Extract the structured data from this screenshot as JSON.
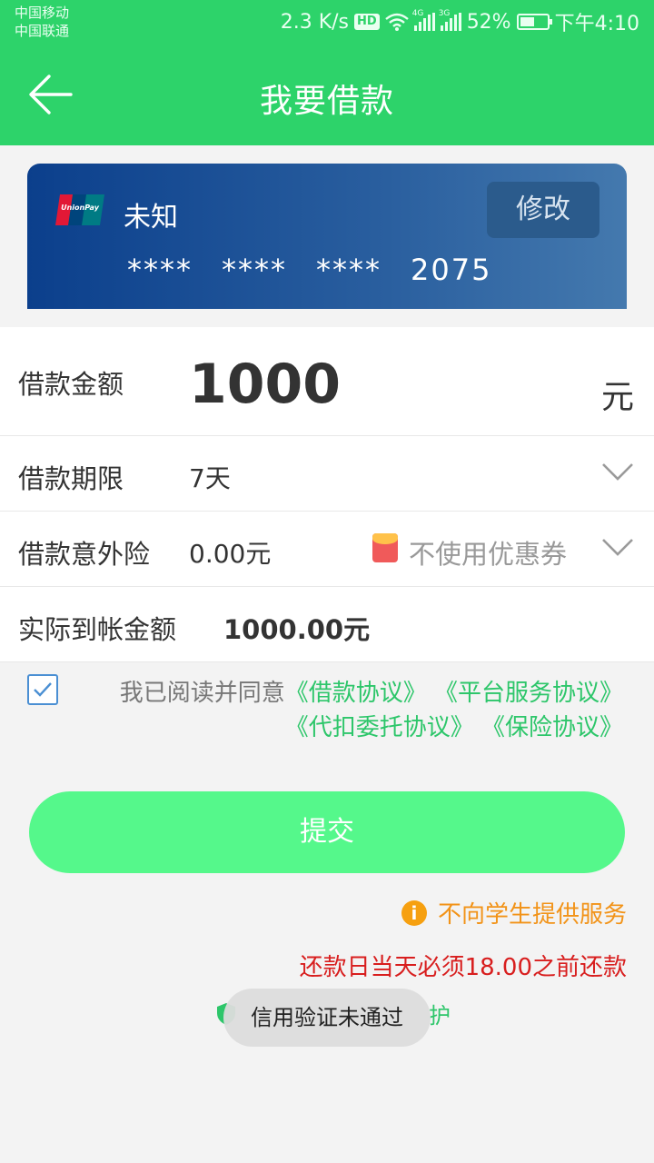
{
  "status_bar": {
    "carrier_1": "中国移动",
    "carrier_2": "中国联通",
    "speed": "2.3 K/s",
    "hd_badge": "HD",
    "net_1": "4G",
    "net_2": "3G",
    "battery": "52%",
    "battery_level": 0.52,
    "time": "下午4:10"
  },
  "header": {
    "title": "我要借款",
    "back_icon": "arrow-left-icon",
    "color": "#2dd36a"
  },
  "card": {
    "brand_logo": "unionpay-icon",
    "name": "未知",
    "modify_label": "修改",
    "number_groups": [
      "****",
      "****",
      "****",
      "2075"
    ]
  },
  "form": {
    "amount_label": "借款金额",
    "amount_value": "1000",
    "amount_unit": "元",
    "term_label": "借款期限",
    "term_value": "7天",
    "insurance_label": "借款意外险",
    "insurance_value": "0.00元",
    "coupon_text": "不使用优惠券",
    "received_label": "实际到帐金额",
    "received_value": "1000.00元"
  },
  "agreement": {
    "checked": true,
    "prefix": "我已阅读并同意",
    "links": [
      "《借款协议》",
      "《平台服务协议》",
      "《代扣委托协议》",
      "《保险协议》"
    ]
  },
  "submit_label": "提交",
  "notice_text": "不向学生提供服务",
  "repay_note": "还款日当天必须18.00之前还款",
  "secure_text": "护",
  "toast": "信用验证未通过",
  "colors": {
    "accent": "#2dd36a",
    "link": "#2dc66a",
    "warning": "#f29318",
    "danger": "#d81e1e",
    "submit": "#55f88b"
  }
}
